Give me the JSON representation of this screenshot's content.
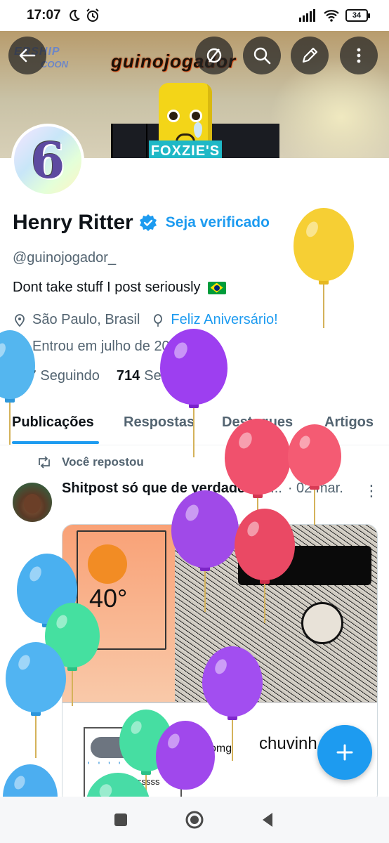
{
  "status_bar": {
    "time": "17:07",
    "battery": "34"
  },
  "banner": {
    "title": "guinojogador",
    "bg_text_1": "ERSHIP",
    "bg_text_2": "COON",
    "box_text": "FOXZIE'S",
    "temp": "40°"
  },
  "profile": {
    "name": "Henry Ritter",
    "verify_link": "Seja verificado",
    "handle": "@guinojogador_",
    "bio": "Dont take stuff I post seriously",
    "location": "São Paulo, Brasil",
    "birthday": "Feliz Aniversário!",
    "joined": "Entrou em julho de 2022",
    "following_count": "227",
    "following_label": "Seguindo",
    "followers_count": "714",
    "followers_label": "Seguidores"
  },
  "tabs": [
    {
      "label": "Publicações",
      "active": true
    },
    {
      "label": "Respostas",
      "active": false
    },
    {
      "label": "Destaques",
      "active": false
    },
    {
      "label": "Artigos",
      "active": false
    }
  ],
  "post": {
    "repost_label": "Você repostou",
    "author": "Shitpost só que de verdade",
    "ellipsis": "...",
    "date": "· 02 mar.",
    "more": "⋮",
    "meme": {
      "temp": "40°",
      "rain": "' ' ' ' ' '",
      "s_text": "sssssssss",
      "omg": "omg",
      "chuv": "chuvinh"
    }
  },
  "colors": {
    "accent": "#1d9bf0",
    "text_primary": "#0f1419",
    "text_secondary": "#536471"
  },
  "icons": {
    "back": "arrow-left-icon",
    "hide": "eye-slash-icon",
    "search": "search-icon",
    "edit": "pencil-icon",
    "more": "more-vertical-icon",
    "fab": "plus-icon",
    "nav_recents": "square-icon",
    "nav_home": "circle-icon",
    "nav_back": "triangle-back-icon"
  }
}
